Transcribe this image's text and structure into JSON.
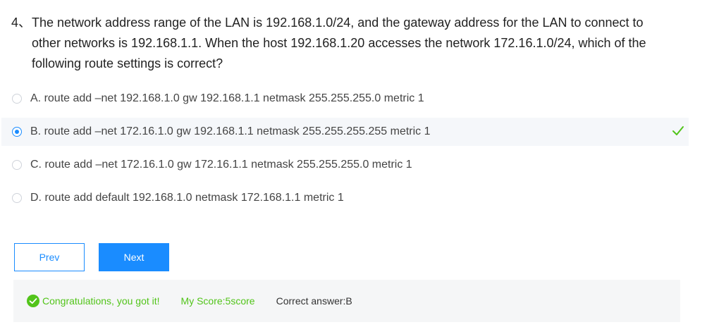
{
  "question": {
    "number": "4、",
    "text": "The network address range of the LAN is 192.168.1.0/24, and the gateway address for the LAN to connect to other networks is 192.168.1.1. When the host 192.168.1.20 accesses the network 172.16.1.0/24, which of the following route settings is correct?"
  },
  "options": [
    {
      "label": "A. route add –net 192.168.1.0 gw 192.168.1.1 netmask 255.255.255.0 metric 1"
    },
    {
      "label": "B. route add –net 172.16.1.0 gw 192.168.1.1 netmask 255.255.255.255 metric 1"
    },
    {
      "label": "C. route add –net 172.16.1.0 gw 172.16.1.1 netmask 255.255.255.0 metric 1"
    },
    {
      "label": "D. route add default 192.168.1.0 netmask 172.168.1.1 metric 1"
    }
  ],
  "selected_option": "B",
  "buttons": {
    "prev_label": "Prev",
    "next_label": "Next"
  },
  "result": {
    "congrats": "Congratulations, you got it!",
    "score": "My Score:5score",
    "correct_answer": "Correct answer:B"
  },
  "colors": {
    "accent": "#1a8cff",
    "success": "#52c41a",
    "selected_row_bg": "#f5f7fa",
    "result_bar_bg": "#f5f6f7"
  },
  "icons": {
    "correct_mark": "checkmark-icon",
    "success_badge": "check-circle-icon"
  }
}
